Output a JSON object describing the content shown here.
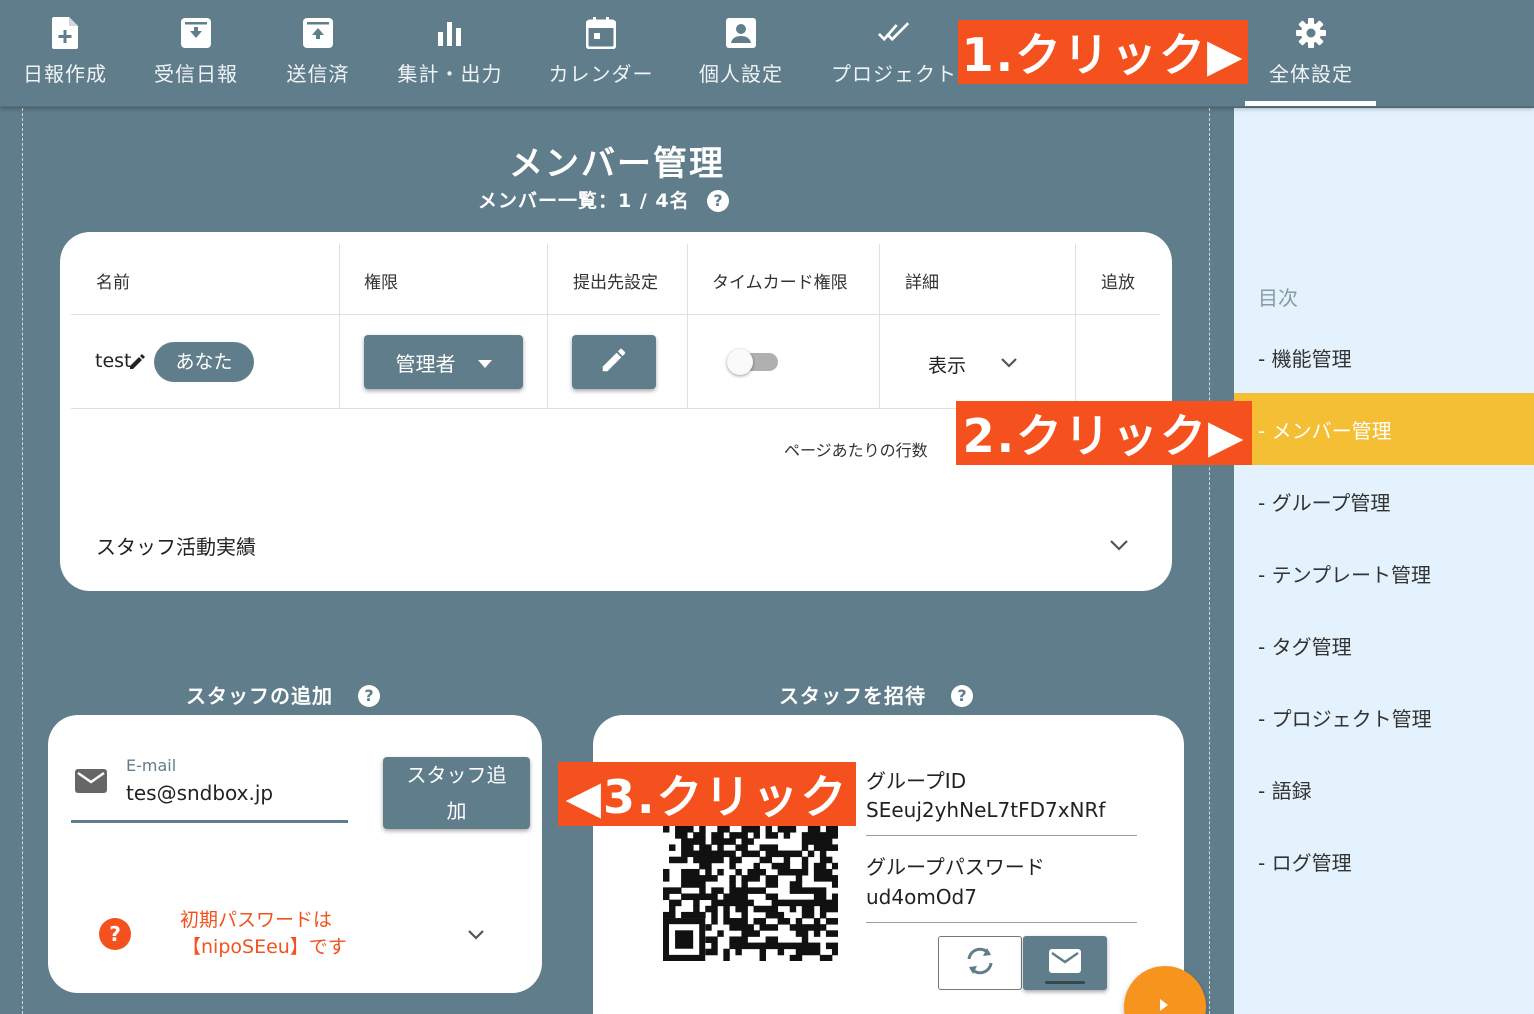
{
  "nav": {
    "items": [
      {
        "label": "日報作成",
        "icon": "file-plus-icon"
      },
      {
        "label": "受信日報",
        "icon": "inbox-download-icon"
      },
      {
        "label": "送信済",
        "icon": "inbox-upload-icon"
      },
      {
        "label": "集計・出力",
        "icon": "bar-chart-icon"
      },
      {
        "label": "カレンダー",
        "icon": "calendar-icon"
      },
      {
        "label": "個人設定",
        "icon": "account-box-icon"
      },
      {
        "label": "プロジェクト",
        "icon": "double-check-icon"
      },
      {
        "label": "全体設定",
        "icon": "gear-icon"
      }
    ],
    "active": "全体設定"
  },
  "callouts": {
    "step1": "1.クリック▶",
    "step2": "2.クリック▶",
    "step3": "◀3.クリック"
  },
  "main": {
    "title": "メンバー管理",
    "member_count": "メンバー一覧：1 / 4名",
    "help": "?",
    "table": {
      "headers": [
        "名前",
        "権限",
        "提出先設定",
        "タイムカード権限",
        "詳細",
        "追放"
      ],
      "rows": [
        {
          "name": "test",
          "you_chip": "あなた",
          "role": "管理者",
          "detail": "表示",
          "timecard_enabled": false
        }
      ],
      "rows_per_page_label": "ページあたりの行数"
    },
    "staff_activity": "スタッフ活動実績"
  },
  "add_staff": {
    "title": "スタッフの追加",
    "email_label": "E-mail",
    "email_value": "tes@sndbox.jp",
    "add_button_line1": "スタッフ追",
    "add_button_line2": "加",
    "notice_line1": "初期パスワードは",
    "notice_line2": "【nipoSEeu】です"
  },
  "invite_staff": {
    "title": "スタッフを招待",
    "group_id_label": "グループID",
    "group_id_value": "SEeuj2yhNeL7tFD7xNRf",
    "group_password_label": "グループパスワード",
    "group_password_value": "ud4omOd7"
  },
  "sidebar": {
    "toc_title": "目次",
    "items": [
      {
        "label": "- 機能管理"
      },
      {
        "label": "- メンバー管理",
        "active": true
      },
      {
        "label": "- グループ管理"
      },
      {
        "label": "- テンプレート管理"
      },
      {
        "label": "- タグ管理"
      },
      {
        "label": "- プロジェクト管理"
      },
      {
        "label": "- 語録"
      },
      {
        "label": "- ログ管理"
      }
    ]
  },
  "colors": {
    "primary": "#607d8b",
    "sidebar_bg": "#e3f2fd",
    "active_toc": "#f4bf35",
    "callout": "#f4511e",
    "warning": "#f4511e",
    "fab": "#f7941d"
  }
}
